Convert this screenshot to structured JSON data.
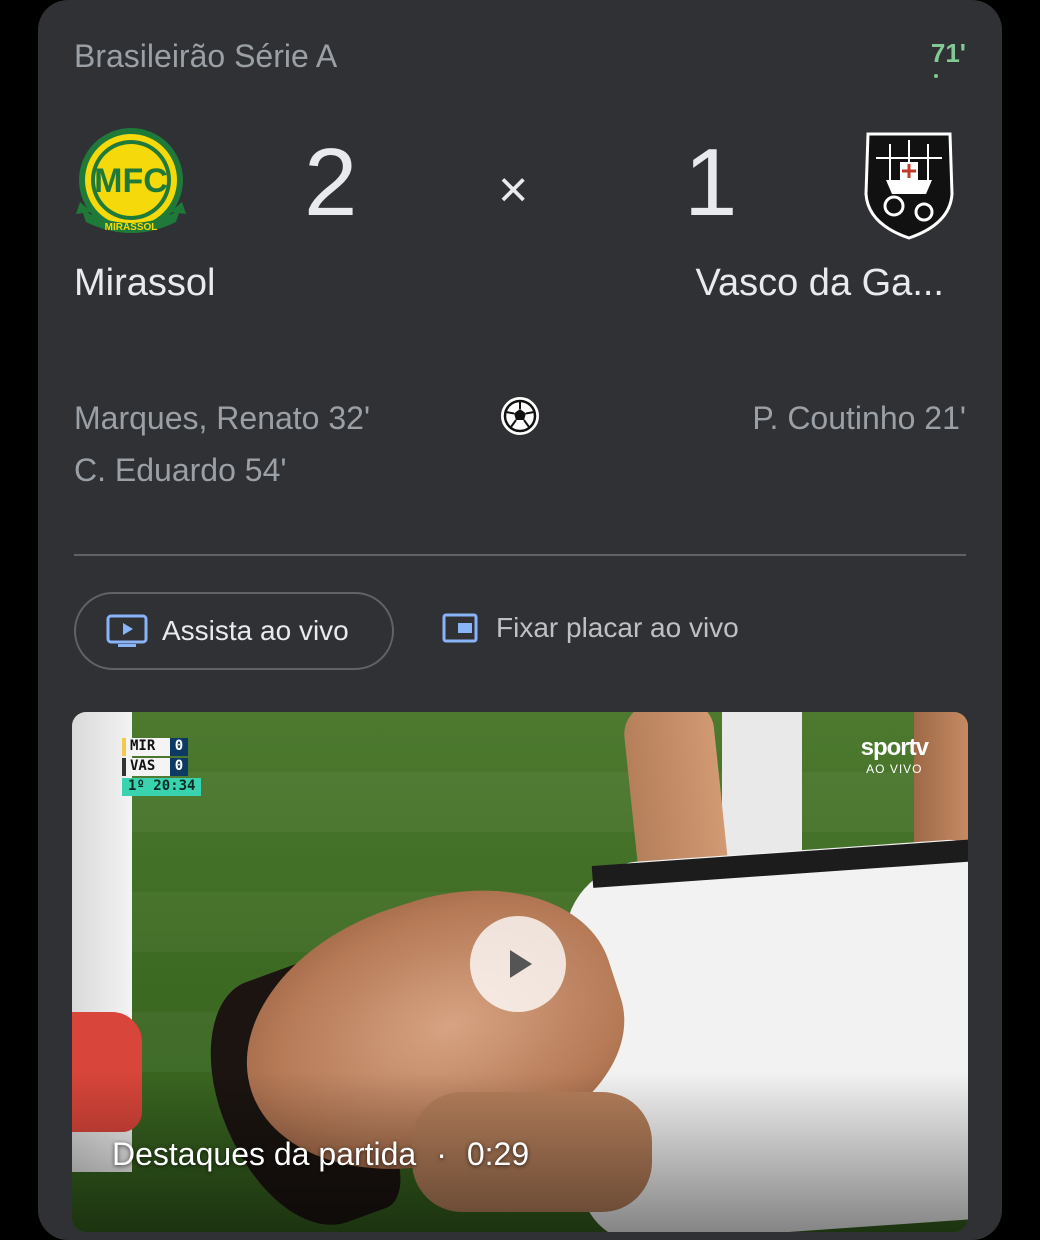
{
  "match": {
    "league": "Brasileirão Série A",
    "minute": "71'",
    "separator": "×",
    "home": {
      "name": "Mirassol",
      "score": "2",
      "logo_text": "MFC",
      "logo_subtext": "MIRASSOL",
      "scorers": [
        "Marques, Renato 32'",
        "C. Eduardo 54'"
      ]
    },
    "away": {
      "name": "Vasco da Ga...",
      "score": "1",
      "scorers": [
        "P. Coutinho 21'"
      ]
    },
    "goal_icon": "soccer-ball-icon"
  },
  "actions": {
    "watch_live": "Assista ao vivo",
    "pin_score": "Fixar placar ao vivo"
  },
  "video": {
    "caption": "Destaques da partida",
    "separator": "·",
    "duration": "0:29",
    "scoreboard": {
      "home_abbr": "MIR",
      "home_score": "0",
      "away_abbr": "VAS",
      "away_score": "0",
      "clock": "1º 20:34"
    },
    "broadcaster": "sportv",
    "broadcaster_sub": "AO VIVO"
  },
  "colors": {
    "card_bg": "#303134",
    "live_green": "#81c995",
    "text_primary": "#e8eaed",
    "text_secondary": "#9aa0a6"
  }
}
